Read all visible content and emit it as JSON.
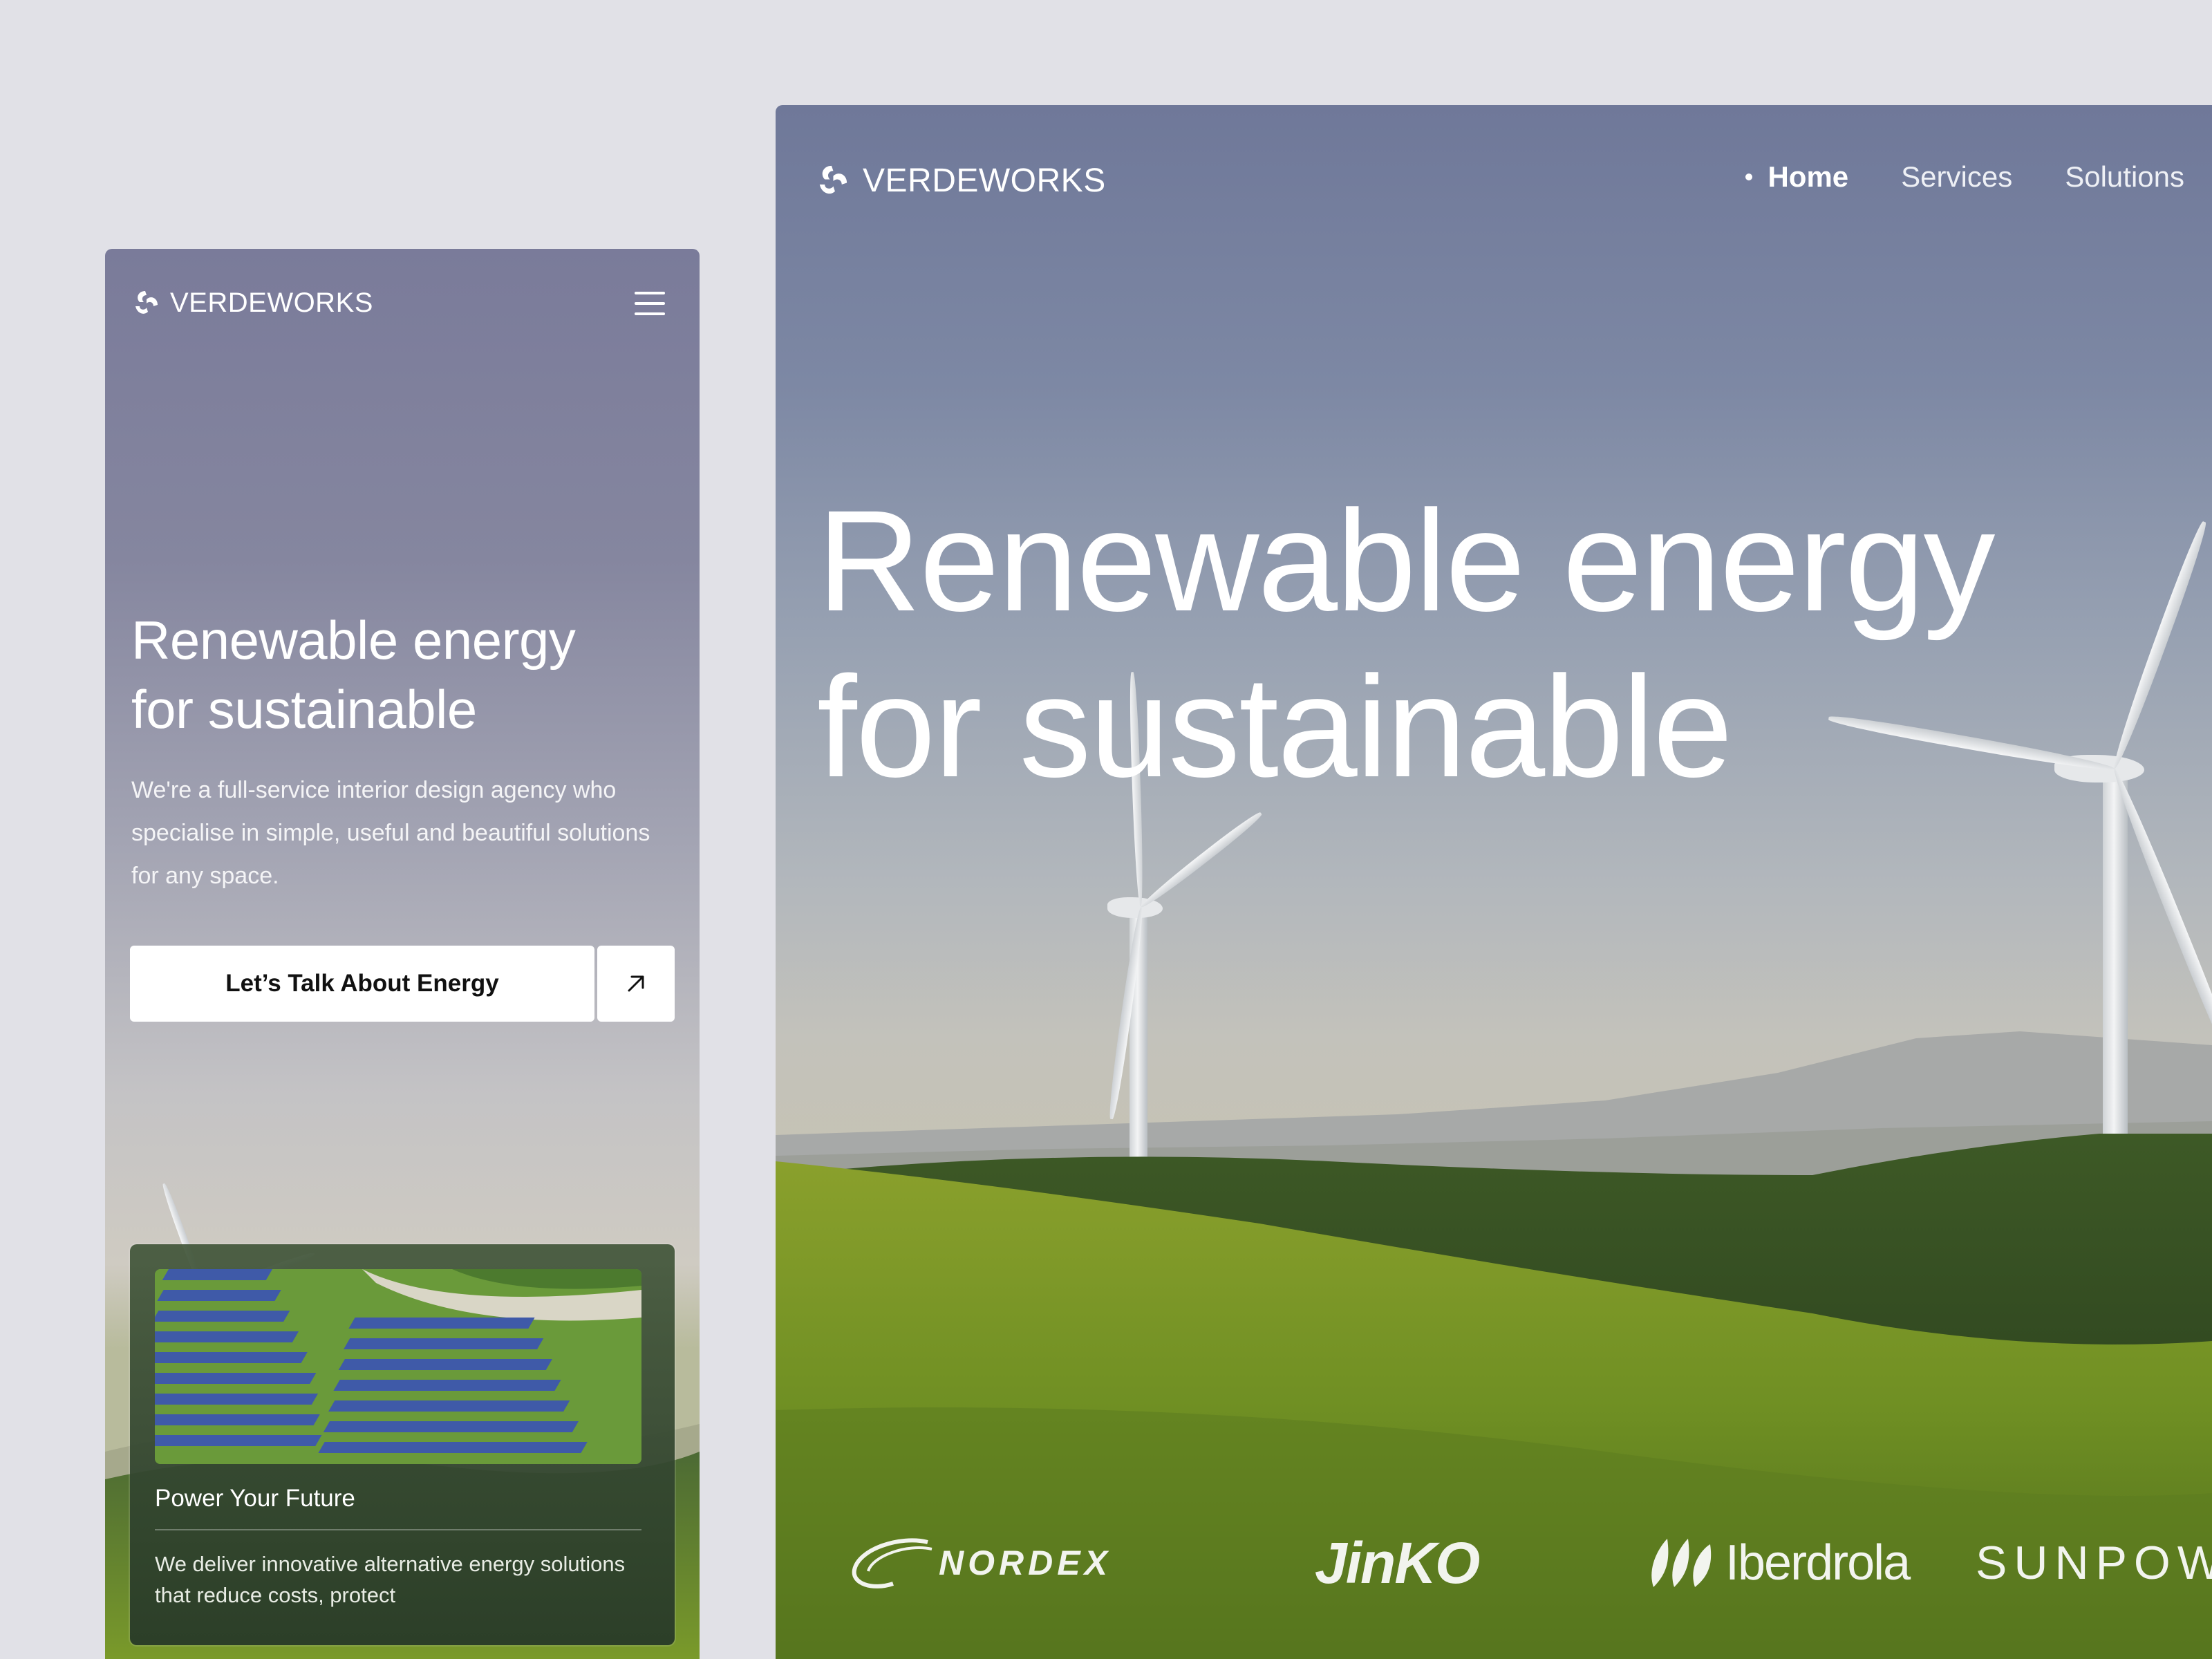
{
  "brand": {
    "name": "VERDEWORKS",
    "logo_icon": "swirl-logo-icon"
  },
  "mobile": {
    "menu_icon": "hamburger-menu-icon",
    "hero": {
      "title_line1": "Renewable energy",
      "title_line2": "for sustainable",
      "description": "We're a full-service interior design agency who specialise in simple, useful and beautiful solutions for any space."
    },
    "cta": {
      "label": "Let’s Talk About Energy",
      "arrow_icon": "arrow-up-right-icon"
    },
    "card": {
      "title": "Power Your Future",
      "description": "We deliver innovative alternative energy solutions that reduce costs, protect"
    }
  },
  "desktop": {
    "nav": [
      {
        "label": "Home",
        "active": true
      },
      {
        "label": "Services",
        "active": false
      },
      {
        "label": "Solutions",
        "active": false
      }
    ],
    "hero": {
      "title_line1": "Renewable energy",
      "title_line2": "for sustainable"
    },
    "partners": [
      "NORDEX",
      "JinKO",
      "Iberdrola",
      "SUNPOWER"
    ]
  },
  "colors": {
    "page_bg": "#e1e1e7",
    "text": "#ffffff",
    "button_bg": "#ffffff",
    "button_text": "#111111",
    "field_green": "#6f8f23"
  }
}
